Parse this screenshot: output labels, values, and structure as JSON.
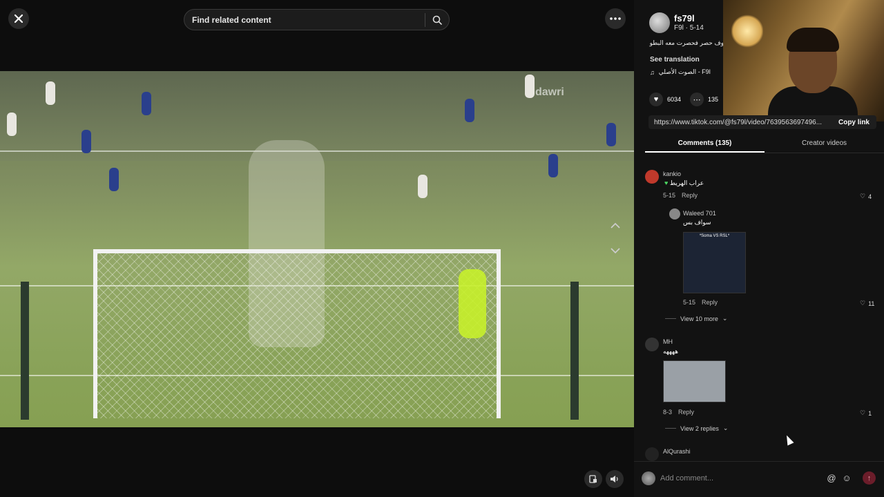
{
  "search": {
    "placeholder": "Find related content"
  },
  "video": {
    "watermark": "dawri"
  },
  "author": {
    "username": "fs79l",
    "meta": "F9l · 5-14",
    "description": "وف حصر فحصرت معه البطولات، الشاك كما يعرف الأعلترى طريق",
    "see_translation": "See translation",
    "sound": "الصوت الأصلي - F9l"
  },
  "stats": {
    "likes": "6034",
    "comments": "135"
  },
  "link": {
    "url": "https://www.tiktok.com/@fs79l/video/7639563697496...",
    "copy_label": "Copy link"
  },
  "tabs": [
    {
      "label": "Comments (135)"
    },
    {
      "label": "Creator videos"
    }
  ],
  "comments": [
    {
      "name": "kankio",
      "text": "عراب الهريط",
      "date": "5-15",
      "reply": "Reply",
      "likes": "4"
    },
    {
      "name": "Waleed 701",
      "text": "سواف بس",
      "date": "5-15",
      "reply": "Reply",
      "likes": "11",
      "view_more": "View 10 more",
      "thumb_caption": "*Soma VS RSL*"
    },
    {
      "name": "MH",
      "text": "ههههه",
      "date": "8-3",
      "reply": "Reply",
      "likes": "1",
      "view_more": "View 2 replies"
    },
    {
      "name": "AlQurashi",
      "text": ""
    }
  ],
  "comment_bar": {
    "placeholder": "Add comment..."
  },
  "colors": {
    "accent": "#fe2c55",
    "panel_bg": "#121212"
  }
}
